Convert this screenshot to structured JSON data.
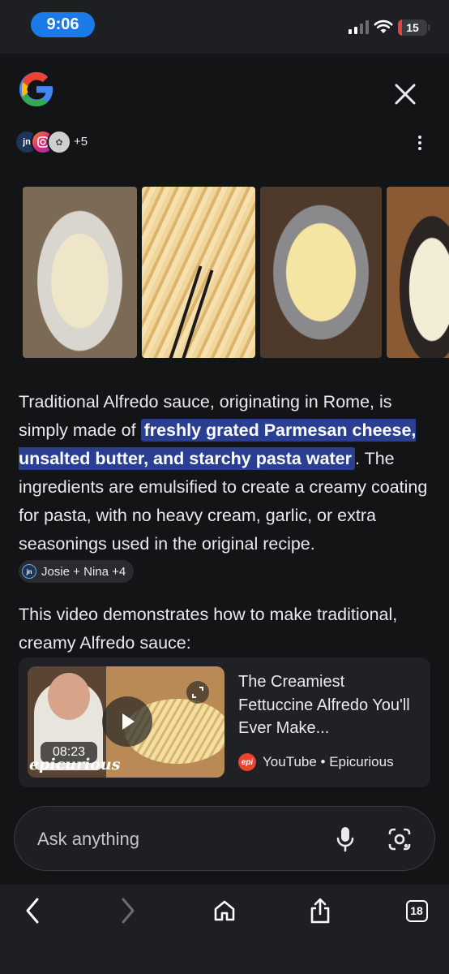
{
  "status_bar": {
    "time": "9:06",
    "battery_level": "15",
    "signal_bars": 2,
    "signal_bars_total": 4
  },
  "header": {
    "logo_icon": "google-g-logo",
    "close_icon": "close-icon",
    "menu_icon": "more-vertical-icon",
    "source_avatars": [
      "jn",
      "instagram",
      "plate"
    ],
    "more_sources": "+5"
  },
  "images": [
    {
      "name": "fettuccine-bowl-image"
    },
    {
      "name": "fettuccine-chopsticks-image"
    },
    {
      "name": "fettuccine-pan-image"
    },
    {
      "name": "alfredo-sauce-pot-image"
    }
  ],
  "answer": {
    "intro": "Traditional Alfredo sauce, originating in Rome, is simply made of ",
    "highlight": "freshly grated Parmesan cheese, unsalted butter, and starchy pasta water",
    "rest": ". The ingredients are emulsified to create a creamy coating for pasta, with no heavy cream, garlic, or extra seasonings used in the original recipe.",
    "source_chip": {
      "avatar_text": "jn",
      "label": "Josie + Nina +4"
    }
  },
  "video_section": {
    "intro": "This video demonstrates how to make traditional, creamy Alfredo sauce:",
    "card": {
      "title": "The Creamiest Fettuccine Alfredo You'll Ever Make...",
      "duration": "08:23",
      "watermark": "epicurious",
      "source_icon_text": "epi",
      "source": "YouTube • Epicurious"
    }
  },
  "ask_bar": {
    "placeholder": "Ask anything",
    "mic_icon": "mic-icon",
    "lens_icon": "camera-lens-icon"
  },
  "toolbar": {
    "back_icon": "back-icon",
    "forward_icon": "forward-icon",
    "home_icon": "home-icon",
    "share_icon": "share-icon",
    "tab_count": "18"
  },
  "colors": {
    "accent_blue": "#1a7ae8",
    "highlight_bg": "#2b3f92",
    "battery_low": "#e5443c",
    "panel_bg": "#131416"
  }
}
